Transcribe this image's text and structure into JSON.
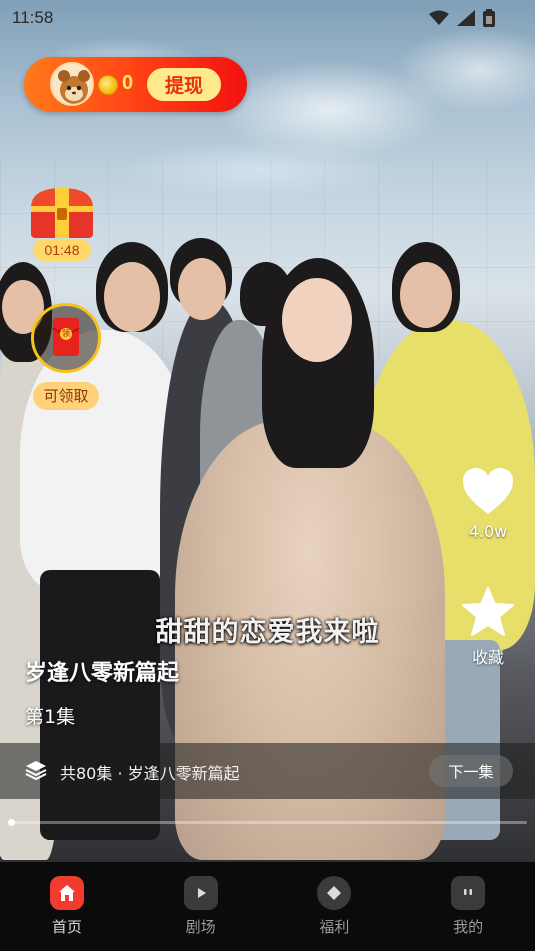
{
  "status_bar": {
    "time": "11:58",
    "icons": [
      "wifi-icon",
      "cellular-signal-icon",
      "battery-icon"
    ]
  },
  "rewards": {
    "coin_count": "0",
    "withdraw_label": "提现",
    "chest_timer": "01:48",
    "envelope_badge": "领",
    "envelope_claim_label": "可领取"
  },
  "side_actions": {
    "like_count": "4.0w",
    "collect_label": "收藏"
  },
  "video": {
    "subtitle": "甜甜的恋爱我来啦",
    "drama_title": "岁逢八零新篇起",
    "episode_label": "第1集",
    "progress": 0.006
  },
  "episode_bar": {
    "summary": "共80集 · 岁逢八零新篇起",
    "next_label": "下一集"
  },
  "bottom_nav": {
    "items": [
      {
        "label": "首页",
        "icon": "home-icon",
        "active": true
      },
      {
        "label": "剧场",
        "icon": "play-tag-icon",
        "active": false
      },
      {
        "label": "福利",
        "icon": "diamond-icon",
        "active": false
      },
      {
        "label": "我的",
        "icon": "profile-face-icon",
        "active": false
      }
    ]
  },
  "colors": {
    "accent_red": "#f23b2f",
    "coin_yellow": "#ffe766",
    "withdraw_bg": "#ffe98d"
  }
}
